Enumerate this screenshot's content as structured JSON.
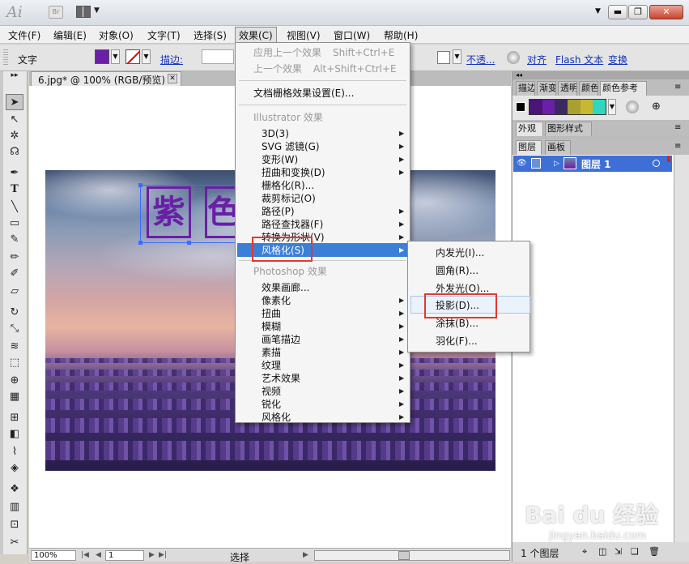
{
  "titlebar": {
    "app_logo": "Ai",
    "bridge_label": "Br",
    "window_buttons": {
      "minimize": "▬",
      "maximize": "❐",
      "close": "✕"
    }
  },
  "menubar": {
    "items": [
      "文件(F)",
      "编辑(E)",
      "对象(O)",
      "文字(T)",
      "选择(S)",
      "效果(C)",
      "视图(V)",
      "窗口(W)",
      "帮助(H)"
    ],
    "active": "效果(C)"
  },
  "controlbar": {
    "context_label": "文字",
    "fill_color": "#6a1fa6",
    "stroke_label": "描边:",
    "opacity_link": "不透...",
    "align_link": "对齐",
    "flash_text_link": "Flash 文本",
    "transform_link": "变换"
  },
  "document": {
    "tab_title": "6.jpg* @ 100% (RGB/预览)",
    "glyphs": [
      "紫",
      "色"
    ]
  },
  "statusbar": {
    "zoom": "100%",
    "page": "1",
    "tool_status": "选择"
  },
  "effect_menu": {
    "apply_last": {
      "label": "应用上一个效果",
      "shortcut": "Shift+Ctrl+E"
    },
    "last_effect": {
      "label": "上一个效果",
      "shortcut": "Alt+Shift+Ctrl+E"
    },
    "raster_settings": "文档栅格效果设置(E)...",
    "illustrator_header": "Illustrator 效果",
    "illustrator_items": [
      "3D(3)",
      "SVG 滤镜(G)",
      "变形(W)",
      "扭曲和变换(D)",
      "栅格化(R)...",
      "裁剪标记(O)",
      "路径(P)",
      "路径查找器(F)",
      "转换为形状(V)",
      "风格化(S)"
    ],
    "photoshop_header": "Photoshop 效果",
    "photoshop_items": [
      "效果画廊...",
      "像素化",
      "扭曲",
      "模糊",
      "画笔描边",
      "素描",
      "纹理",
      "艺术效果",
      "视频",
      "锐化",
      "风格化"
    ],
    "highlighted": "风格化(S)"
  },
  "stylize_submenu": {
    "items": [
      "内发光(I)...",
      "圆角(R)...",
      "外发光(O)...",
      "投影(D)...",
      "涂抹(B)...",
      "羽化(F)..."
    ],
    "hover": "投影(D)..."
  },
  "right_panels": {
    "swatch_tabs": [
      "描边",
      "渐变",
      "透明",
      "颜色",
      "颜色参考"
    ],
    "swatch_colors": [
      "#000000",
      "#4b1478",
      "#6a1fa6",
      "#3b2a60",
      "#a8a030",
      "#c8b830",
      "#2fd6c0"
    ],
    "appearance_tabs": [
      "外观",
      "图形样式"
    ],
    "layer_tabs": [
      "图层",
      "画板"
    ],
    "layer_name": "图层 1",
    "layer_count": "1 个图层"
  },
  "watermark": {
    "brand": "Bai du 经验",
    "url": "jingyan.baidu.com"
  }
}
